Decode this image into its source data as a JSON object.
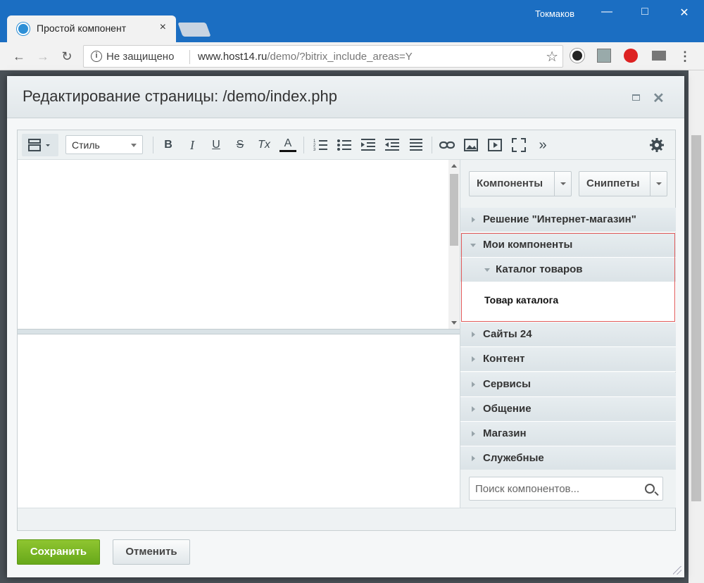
{
  "browser": {
    "tab_title": "Простой компонент",
    "tab_close": "×",
    "user_name": "Токмаков",
    "url_security": "Не защищено",
    "url_host": "www.host14.ru",
    "url_path": "/demo/?bitrix_include_areas=Y"
  },
  "dialog": {
    "title": "Редактирование страницы: /demo/index.php"
  },
  "toolbar": {
    "style_select": "Стиль",
    "bold": "B",
    "italic": "I",
    "underline": "U",
    "strike": "S",
    "clear_format": "Tx",
    "font_color": "A",
    "more": "»"
  },
  "panel": {
    "components_button": "Компоненты",
    "snippets_button": "Сниппеты",
    "tree": [
      {
        "label": "Решение \"Интернет-магазин\"",
        "state": "collapsed"
      },
      {
        "label": "Мои компоненты",
        "state": "expanded"
      },
      {
        "label": "Каталог товаров",
        "state": "expanded",
        "level": 2
      },
      {
        "label": "Товар каталога",
        "state": "leaf",
        "level": 3
      },
      {
        "label": "Сайты 24",
        "state": "collapsed"
      },
      {
        "label": "Контент",
        "state": "collapsed"
      },
      {
        "label": "Сервисы",
        "state": "collapsed"
      },
      {
        "label": "Общение",
        "state": "collapsed"
      },
      {
        "label": "Магазин",
        "state": "collapsed"
      },
      {
        "label": "Служебные",
        "state": "collapsed"
      }
    ],
    "search_placeholder": "Поиск компонентов..."
  },
  "footer": {
    "save_label": "Сохранить",
    "cancel_label": "Отменить"
  },
  "colors": {
    "chrome_blue": "#1b6ec2",
    "save_green": "#7ab826",
    "highlight_red": "#e05a5a"
  }
}
